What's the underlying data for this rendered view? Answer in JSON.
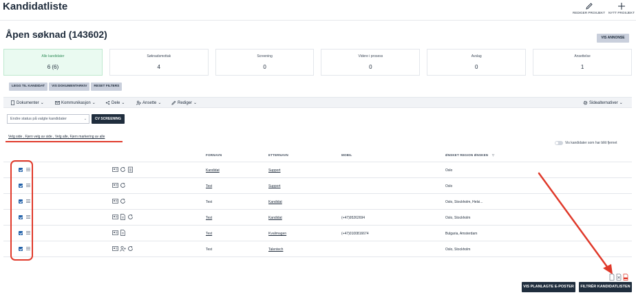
{
  "header": {
    "title": "Kandidatliste",
    "edit_project": "REDIGER PROSJEKT",
    "new_project": "NYTT PROSJEKT"
  },
  "page": {
    "title": "Åpen søknad (143602)",
    "show_ad": "VIS ANNONSE"
  },
  "stats": [
    {
      "label": "Alle kandidater",
      "value": "6 (6)"
    },
    {
      "label": "Søknadsmottak",
      "value": "4"
    },
    {
      "label": "Screening",
      "value": "0"
    },
    {
      "label": "Videre i prosess",
      "value": "0"
    },
    {
      "label": "Avslag",
      "value": "0"
    },
    {
      "label": "Ansettelse",
      "value": "1"
    }
  ],
  "actions": {
    "add_candidate": "LEGG TIL KANDIDAT",
    "show_documents": "VIS DOKUMENTARKIV",
    "reset_filters": "RESET FILTERS"
  },
  "menu": {
    "documents": "Dokumenter",
    "communication": "Kommunikasjon",
    "share": "Dele",
    "hire": "Ansette",
    "edit": "Rediger",
    "page_alternatives": "Sidealternativer"
  },
  "bulk": {
    "status_placeholder": "Endre status på valgte kandidater",
    "cv_screening": "CV SCREENING"
  },
  "selection_links": "Velg side , Fjern velg av side , Velg alle, Fjern markering av alle",
  "toggle_label": "Vis kandidater som har blitt fjernet",
  "table": {
    "headers": {
      "first_name": "FORNAVN",
      "last_name": "ETTERNAVN",
      "mobile": "MOBIL",
      "region": "ØNSKET REGION ØNSKEN"
    },
    "rows": [
      {
        "first_name": "Kandidat",
        "first_link": true,
        "last_name": "Support",
        "mobile": "",
        "region": "Oslo",
        "icons": [
          "cv-icon",
          "refresh-icon",
          "building-icon"
        ]
      },
      {
        "first_name": "Test",
        "first_link": true,
        "last_name": "Support",
        "mobile": "",
        "region": "Oslo",
        "icons": [
          "cv-icon",
          "refresh-icon"
        ]
      },
      {
        "first_name": "Test",
        "first_link": false,
        "last_name": "Kandidat",
        "mobile": "",
        "region": "Oslo, Stockholm, Helsi...",
        "icons": [
          "cv-icon",
          "refresh-icon"
        ]
      },
      {
        "first_name": "Test",
        "first_link": true,
        "last_name": "Kandidat",
        "mobile": "(+47)95262694",
        "region": "Oslo, Stockholm",
        "icons": [
          "cv-icon",
          "document-icon",
          "refresh-icon"
        ]
      },
      {
        "first_name": "Test",
        "first_link": true,
        "last_name": "Kvalimagen",
        "mobile": "(+47)0100816674",
        "region": "Bulgaria, Amsterdam",
        "icons": [
          "cv-icon",
          "document-icon"
        ]
      },
      {
        "first_name": "Test",
        "first_link": false,
        "last_name": "Talentech",
        "mobile": "",
        "region": "Oslo, Stockholm",
        "icons": [
          "cv-icon",
          "person-add-icon",
          "refresh-icon"
        ]
      }
    ]
  },
  "footer": {
    "planned_emails": "VIS PLANLAGTE E-POSTER",
    "filter_list": "FILTRÉR KANDIDATLISTEN"
  },
  "colors": {
    "accent_dark": "#1f2d3d",
    "active_stat": "#eafaf1",
    "annotation_red": "#e0392a"
  }
}
